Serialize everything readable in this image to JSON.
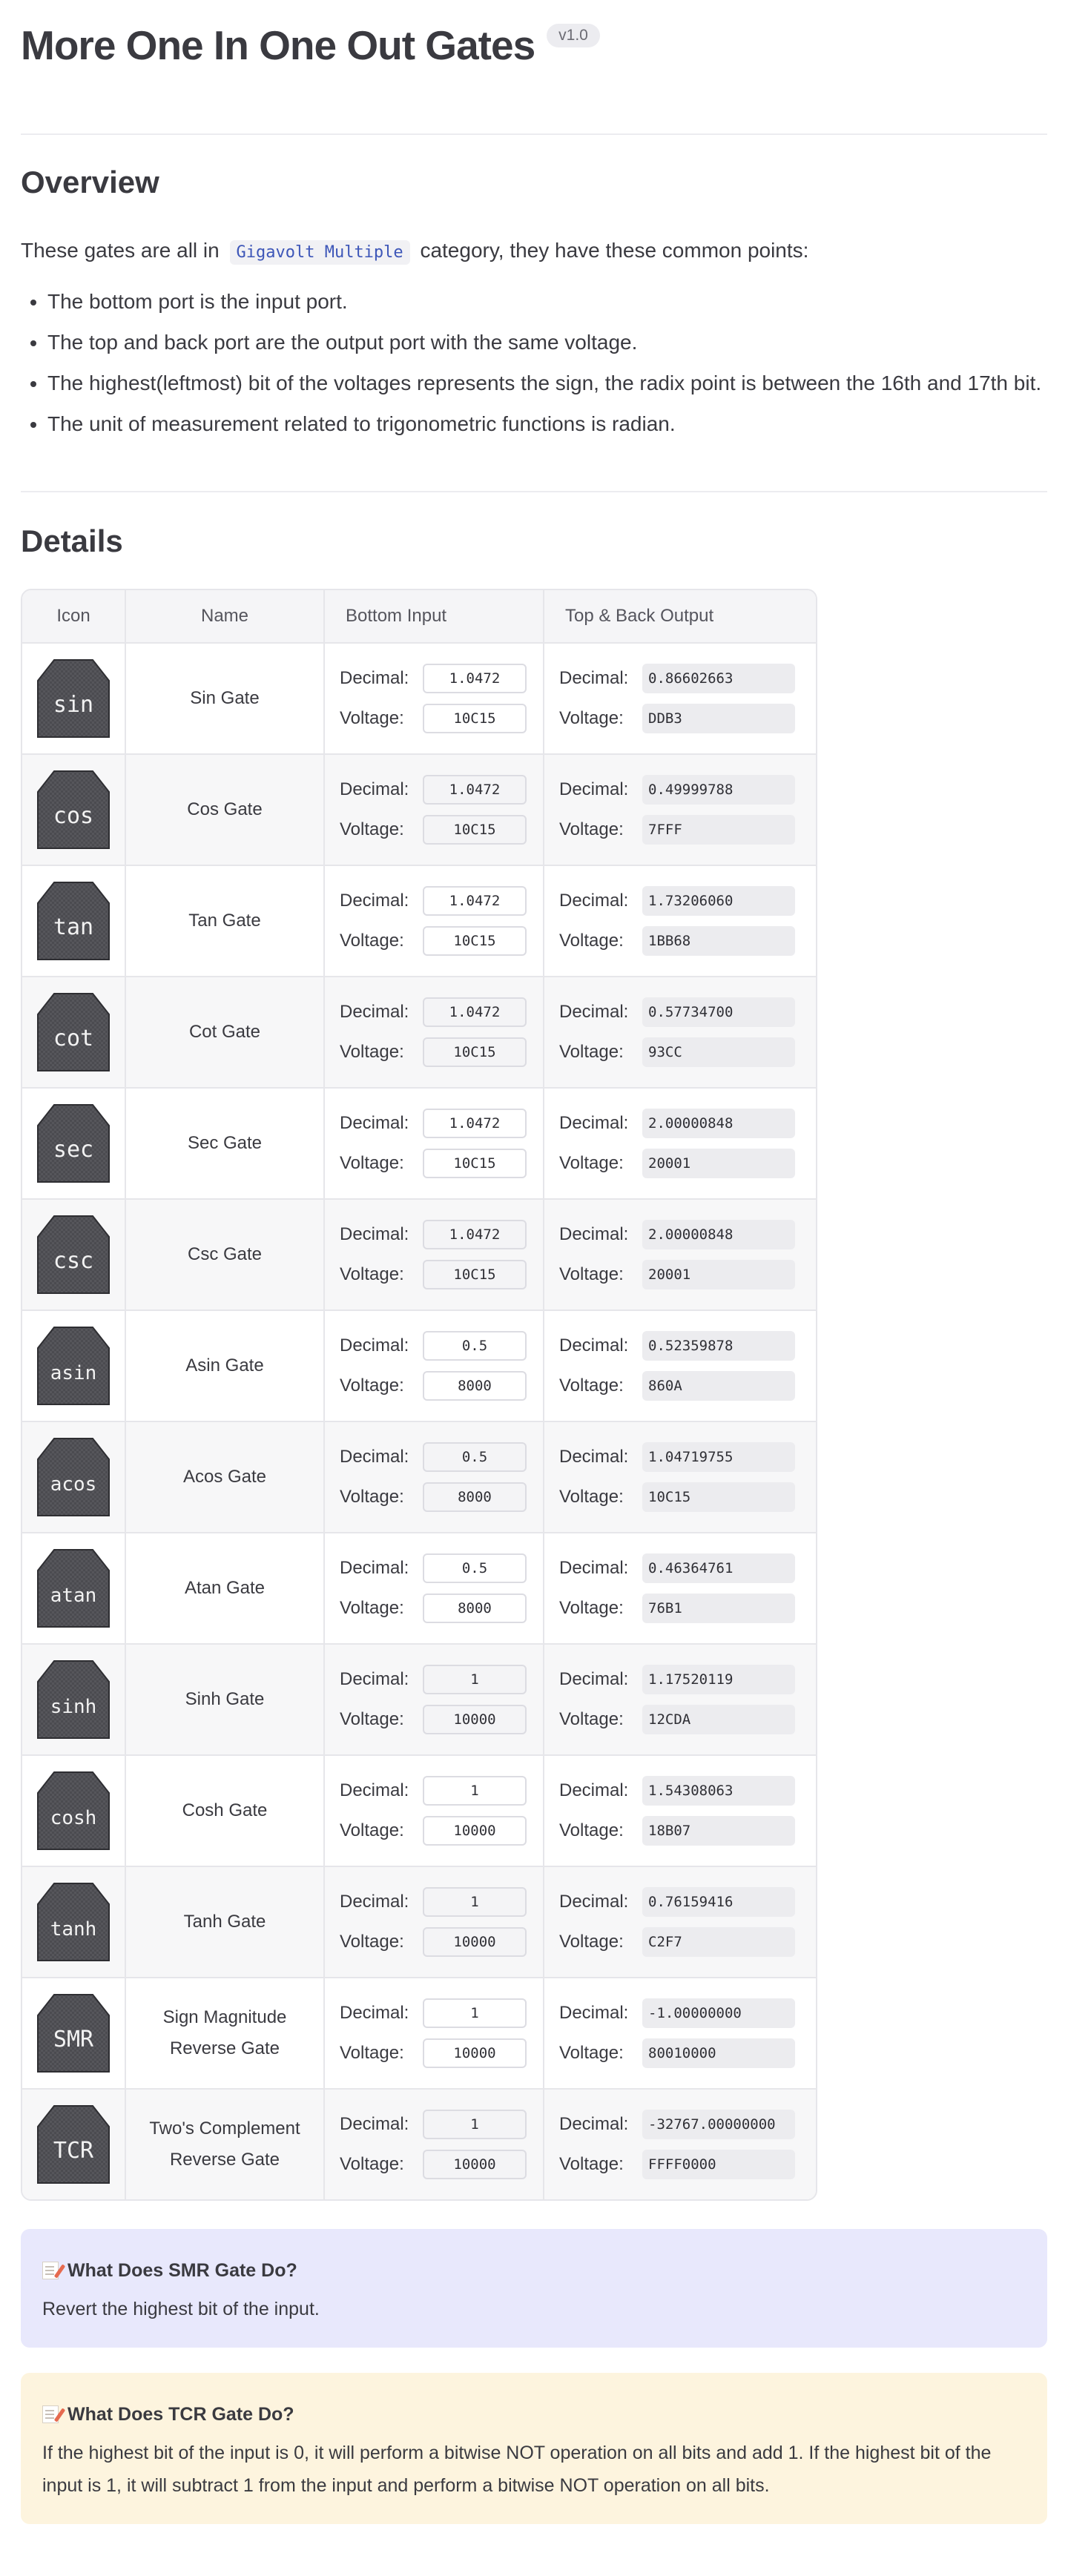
{
  "header": {
    "title": "More One In One Out Gates",
    "version": "v1.0"
  },
  "overview": {
    "heading": "Overview",
    "intro_before": "These gates are all in",
    "category": "Gigavolt Multiple",
    "intro_after": "category, they have these common points:",
    "points": [
      "The bottom port is the input port.",
      "The top and back port are the output port with the same voltage.",
      "The highest(leftmost) bit of the voltages represents the sign, the radix point is between the 16th and 17th bit.",
      "The unit of measurement related to trigonometric functions is radian."
    ]
  },
  "details": {
    "heading": "Details",
    "columns": [
      "Icon",
      "Name",
      "Bottom Input",
      "Top & Back Output"
    ],
    "labels": {
      "decimal": "Decimal:",
      "voltage": "Voltage:"
    },
    "rows": [
      {
        "icon": "sin",
        "name": "Sin Gate",
        "in_dec": "1.0472",
        "in_volt": "10C15",
        "out_dec": "0.86602663",
        "out_volt": "DDB3"
      },
      {
        "icon": "cos",
        "name": "Cos Gate",
        "in_dec": "1.0472",
        "in_volt": "10C15",
        "out_dec": "0.49999788",
        "out_volt": "7FFF"
      },
      {
        "icon": "tan",
        "name": "Tan Gate",
        "in_dec": "1.0472",
        "in_volt": "10C15",
        "out_dec": "1.73206060",
        "out_volt": "1BB68"
      },
      {
        "icon": "cot",
        "name": "Cot Gate",
        "in_dec": "1.0472",
        "in_volt": "10C15",
        "out_dec": "0.57734700",
        "out_volt": "93CC"
      },
      {
        "icon": "sec",
        "name": "Sec Gate",
        "in_dec": "1.0472",
        "in_volt": "10C15",
        "out_dec": "2.00000848",
        "out_volt": "20001"
      },
      {
        "icon": "csc",
        "name": "Csc Gate",
        "in_dec": "1.0472",
        "in_volt": "10C15",
        "out_dec": "2.00000848",
        "out_volt": "20001"
      },
      {
        "icon": "asin",
        "name": "Asin Gate",
        "in_dec": "0.5",
        "in_volt": "8000",
        "out_dec": "0.52359878",
        "out_volt": "860A"
      },
      {
        "icon": "acos",
        "name": "Acos Gate",
        "in_dec": "0.5",
        "in_volt": "8000",
        "out_dec": "1.04719755",
        "out_volt": "10C15"
      },
      {
        "icon": "atan",
        "name": "Atan Gate",
        "in_dec": "0.5",
        "in_volt": "8000",
        "out_dec": "0.46364761",
        "out_volt": "76B1"
      },
      {
        "icon": "sinh",
        "name": "Sinh Gate",
        "in_dec": "1",
        "in_volt": "10000",
        "out_dec": "1.17520119",
        "out_volt": "12CDA"
      },
      {
        "icon": "cosh",
        "name": "Cosh Gate",
        "in_dec": "1",
        "in_volt": "10000",
        "out_dec": "1.54308063",
        "out_volt": "18B07"
      },
      {
        "icon": "tanh",
        "name": "Tanh Gate",
        "in_dec": "1",
        "in_volt": "10000",
        "out_dec": "0.76159416",
        "out_volt": "C2F7"
      },
      {
        "icon": "SMR",
        "name_line1": "Sign Magnitude",
        "name_line2": "Reverse Gate",
        "in_dec": "1",
        "in_volt": "10000",
        "out_dec": "-1.00000000",
        "out_volt": "80010000"
      },
      {
        "icon": "TCR",
        "name_line1": "Two's Complement",
        "name_line2": "Reverse Gate",
        "in_dec": "1",
        "in_volt": "10000",
        "out_dec": "-32767.00000000",
        "out_volt": "FFFF0000"
      }
    ]
  },
  "notes": {
    "smr": {
      "title": "What Does SMR Gate Do?",
      "body": "Revert the highest bit of the input."
    },
    "tcr": {
      "title": "What Does TCR Gate Do?",
      "body": "If the highest bit of the input is 0, it will perform a bitwise NOT operation on all bits and add 1. If the highest bit of the input is 1, it will subtract 1 from the input and perform a bitwise NOT operation on all bits."
    }
  },
  "colors": {
    "accent_chip_text": "#3d56b8",
    "note_smr_bg": "#e8e8fc",
    "note_tcr_bg": "#fdf4de",
    "icon_body": "#4a4a4e"
  },
  "icons": {
    "gate": "gate-chip-icon",
    "note": "memo-icon"
  }
}
